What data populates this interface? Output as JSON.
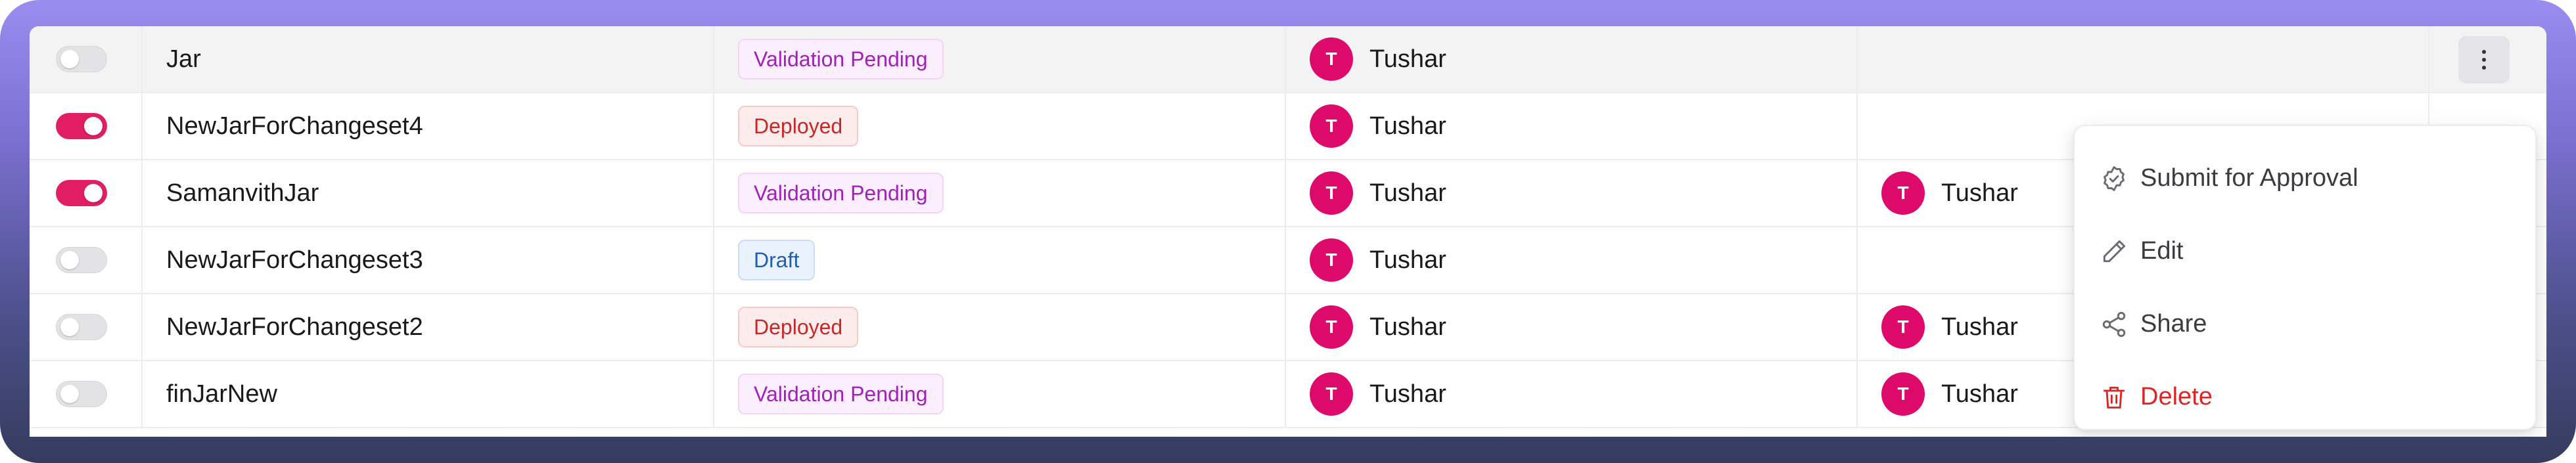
{
  "table": {
    "rows": [
      {
        "toggle_on": false,
        "name": "Jar",
        "status": "Validation Pending",
        "status_kind": "pending",
        "owner_initial": "T",
        "owner": "Tushar",
        "approver_initial": "",
        "approver": "",
        "highlight": true
      },
      {
        "toggle_on": true,
        "name": "NewJarForChangeset4",
        "status": "Deployed",
        "status_kind": "deployed",
        "owner_initial": "T",
        "owner": "Tushar",
        "approver_initial": "",
        "approver": ""
      },
      {
        "toggle_on": true,
        "name": "SamanvithJar",
        "status": "Validation Pending",
        "status_kind": "pending",
        "owner_initial": "T",
        "owner": "Tushar",
        "approver_initial": "T",
        "approver": "Tushar"
      },
      {
        "toggle_on": false,
        "name": "NewJarForChangeset3",
        "status": "Draft",
        "status_kind": "draft",
        "owner_initial": "T",
        "owner": "Tushar",
        "approver_initial": "",
        "approver": ""
      },
      {
        "toggle_on": false,
        "name": "NewJarForChangeset2",
        "status": "Deployed",
        "status_kind": "deployed",
        "owner_initial": "T",
        "owner": "Tushar",
        "approver_initial": "T",
        "approver": "Tushar"
      },
      {
        "toggle_on": false,
        "name": "finJarNew",
        "status": "Validation Pending",
        "status_kind": "pending",
        "owner_initial": "T",
        "owner": "Tushar",
        "approver_initial": "T",
        "approver": "Tushar"
      }
    ]
  },
  "context_menu": {
    "items": [
      {
        "label": "Submit for Approval",
        "icon": "badge-check-icon"
      },
      {
        "label": "Edit",
        "icon": "pencil-icon"
      },
      {
        "label": "Share",
        "icon": "share-icon"
      },
      {
        "label": "Delete",
        "icon": "trash-icon",
        "danger": true
      }
    ]
  },
  "colors": {
    "accent": "#e11d64",
    "avatar": "#dd0a6c",
    "danger": "#dc2626"
  }
}
